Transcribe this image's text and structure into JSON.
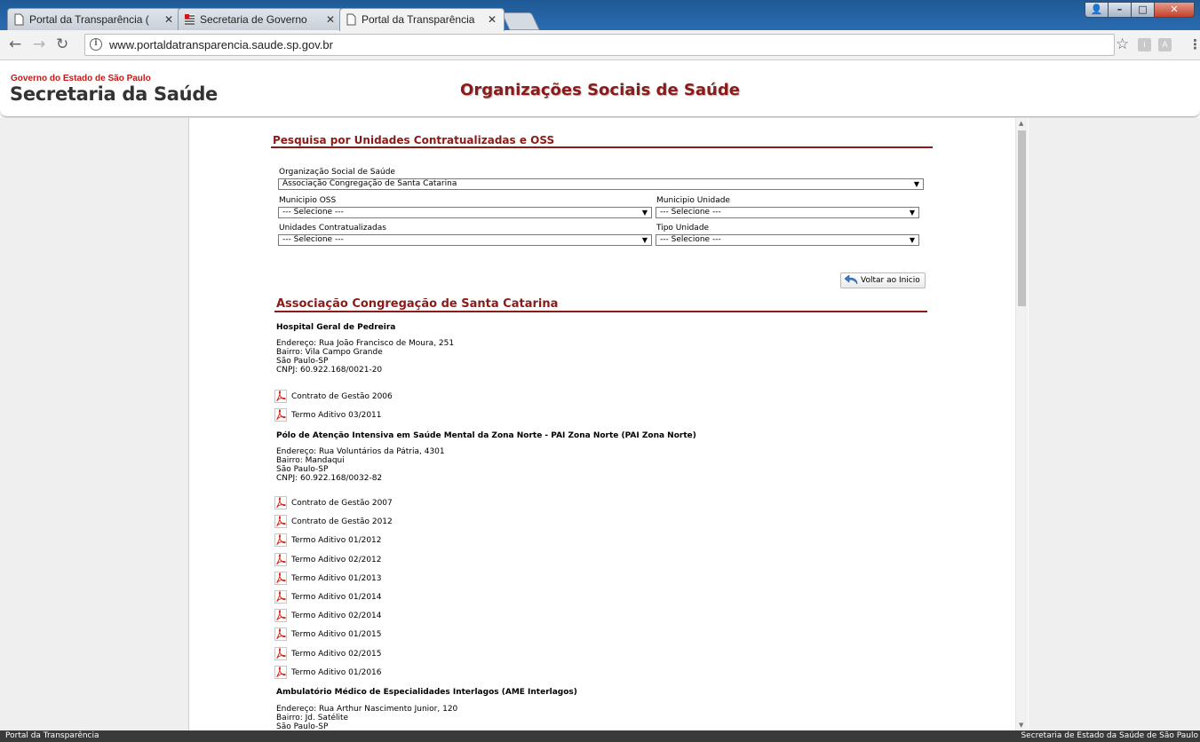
{
  "browser": {
    "tabs": [
      {
        "title": "Portal da Transparência ("
      },
      {
        "title": "Secretaria de Governo"
      },
      {
        "title": "Portal da Transparência"
      }
    ],
    "url": "www.portaldatransparencia.saude.sp.gov.br",
    "extensions": [
      "i",
      "A"
    ]
  },
  "header": {
    "gov_line": "Governo do Estado de São Paulo",
    "sec_line": "Secretaria da Saúde",
    "title": "Organizações Sociais de Saúde"
  },
  "search": {
    "title": "Pesquisa por Unidades Contratualizadas e OSS",
    "org_label": "Organização Social de Saúde",
    "org_value": "Associação Congregação de Santa Catarina",
    "municipio_oss_label": "Municipio OSS",
    "municipio_oss_value": "--- Selecione ---",
    "municipio_unidade_label": "Municipio Unidade",
    "municipio_unidade_value": "--- Selecione ---",
    "unidades_label": "Unidades Contratualizadas",
    "unidades_value": "--- Selecione ---",
    "tipo_label": "Tipo Unidade",
    "tipo_value": "--- Selecione ---"
  },
  "back_label": "Voltar ao Inicio",
  "results": {
    "title": "Associação Congregação de Santa Catarina",
    "units": [
      {
        "name": "Hospital Geral de Pedreira",
        "endereco": "Endereço: Rua João Francisco de Moura, 251",
        "bairro": "Bairro: Vila Campo Grande",
        "cidade": "São Paulo-SP",
        "cnpj": "CNPJ: 60.922.168/0021-20",
        "docs": [
          "Contrato de Gestão 2006",
          "Termo Aditivo 03/2011"
        ]
      },
      {
        "name": "Pólo de Atenção Intensiva em Saúde Mental da Zona Norte - PAI Zona Norte (PAI Zona Norte)",
        "endereco": "Endereço: Rua Voluntários da Pátria, 4301",
        "bairro": "Bairro: Mandaqui",
        "cidade": "São Paulo-SP",
        "cnpj": "CNPJ: 60.922.168/0032-82",
        "docs": [
          "Contrato de Gestão 2007",
          "Contrato de Gestão 2012",
          "Termo Aditivo 01/2012",
          "Termo Aditivo 02/2012",
          "Termo Aditivo 01/2013",
          "Termo Aditivo 01/2014",
          "Termo Aditivo 02/2014",
          "Termo Aditivo 01/2015",
          "Termo Aditivo 02/2015",
          "Termo Aditivo 01/2016"
        ]
      },
      {
        "name": "Ambulatório Médico de Especialidades Interlagos (AME Interlagos)",
        "endereco": "Endereço: Rua Arthur Nascimento Junior, 120",
        "bairro": "Bairro: Jd. Satélite",
        "cidade": "São Paulo-SP"
      }
    ]
  },
  "status": {
    "left": "Portal da Transparência",
    "right": "Secretaria de Estado da Saúde de São Paulo"
  },
  "colors": {
    "accent": "#8b1a1a",
    "gov_red": "#c41a1a",
    "tabstrip": "#2a6bb0"
  }
}
